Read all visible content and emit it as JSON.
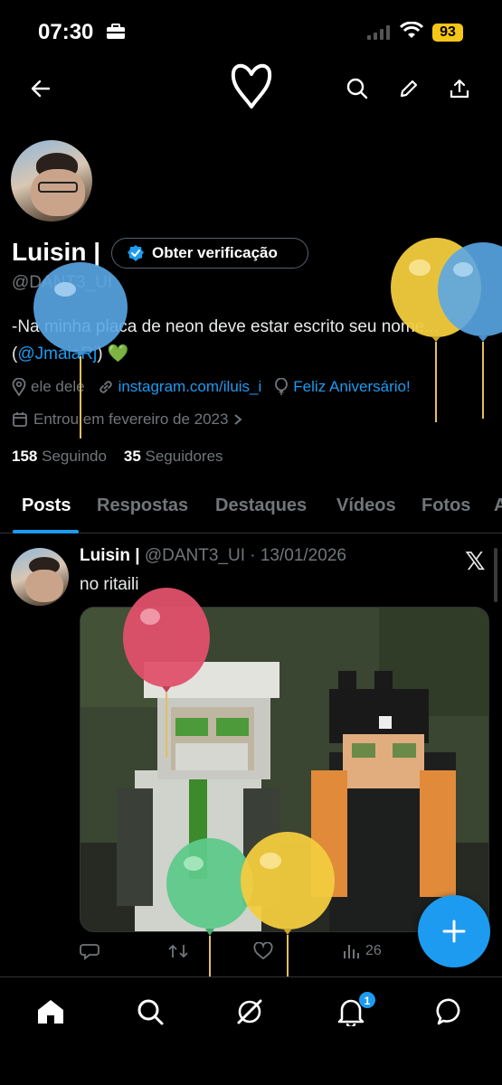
{
  "status_bar": {
    "time": "07:30",
    "battery": "93"
  },
  "header": {
    "back_icon": "arrow-left-icon",
    "center_icon": "heart-outline-icon",
    "icons": [
      "search-icon",
      "pencil-icon",
      "share-icon"
    ]
  },
  "profile": {
    "name": "Luisin |",
    "verify_label": "Obter verificação",
    "handle": "@DANT3_UI",
    "bio_text": "-Na minha placa de neon deve estar escrito seu nome...",
    "bio_mention": "@JmaiaRj",
    "bio_open": "(",
    "bio_close": ")",
    "bio_emoji": "💚",
    "pronouns": "ele dele",
    "website": "instagram.com/iluis_i",
    "birthday": "Feliz Aniversário!",
    "joined": "Entrou em fevereiro de 2023",
    "following_count": "158",
    "following_label": "Seguindo",
    "followers_count": "35",
    "followers_label": "Seguidores"
  },
  "tabs": [
    {
      "label": "Posts",
      "active": true
    },
    {
      "label": "Respostas",
      "active": false
    },
    {
      "label": "Destaques",
      "active": false
    },
    {
      "label": "Vídeos",
      "active": false
    },
    {
      "label": "Fotos",
      "active": false
    },
    {
      "label": "A",
      "active": false
    }
  ],
  "post": {
    "author": "Luisin |",
    "handle_date": "@DANT3_UI · 13/01/2026",
    "text": "no ritaili",
    "views": "26"
  },
  "bottom_nav": {
    "notifications_badge": "1"
  },
  "colors": {
    "accent": "#1d9bf0",
    "background": "#000000",
    "muted": "#71767b",
    "battery": "#f5c518"
  }
}
